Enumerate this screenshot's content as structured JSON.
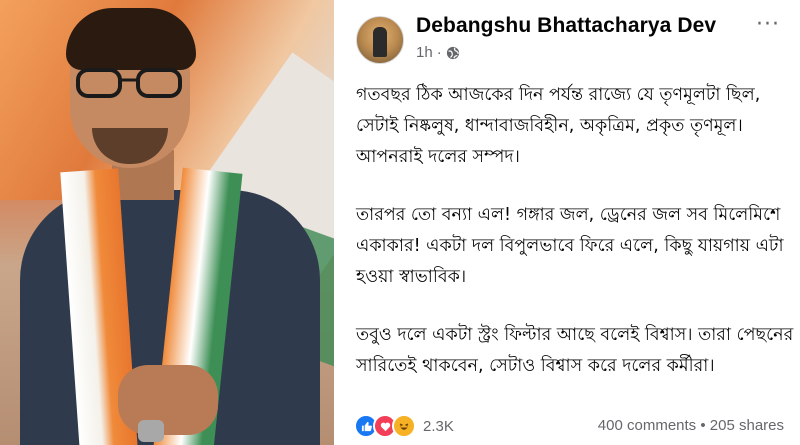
{
  "post": {
    "author": "Debangshu Bhattacharya Dev",
    "time": "1h",
    "time_separator": "·",
    "more_label": "···",
    "paragraphs": [
      "গতবছর ঠিক আজকের দিন পর্যন্ত রাজ্যে যে তৃণমূলটা ছিল, সেটাই নিষ্কলুষ, ধান্দাবাজবিহীন, অকৃত্রিম, প্রকৃত তৃণমূল। আপনরাই দলের সম্পদ।",
      "তারপর তো বন্যা এল! গঙ্গার জল, ড্রেনের জল সব মিলেমিশে একাকার! একটা দল বিপুলভাবে ফিরে এলে, কিছু যায়গায় এটা হওয়া স্বাভাবিক।",
      "তবুও দলে একটা স্ট্রং ফিল্টার আছে বলেই বিশ্বাস। তারা পেছনের সারিতেই থাকবেন, সেটাও বিশ্বাস করে দলের কর্মীরা।"
    ]
  },
  "footer": {
    "reaction_count": "2.3K",
    "comments": "400 comments",
    "shares": "205 shares",
    "stats_separator": " • "
  },
  "colors": {
    "like": "#1877f2",
    "love": "#f33e58",
    "haha": "#f7b125",
    "meta_text": "#65676b"
  },
  "icons": [
    "globe-icon",
    "more-options-icon",
    "like-reaction-icon",
    "love-reaction-icon",
    "haha-reaction-icon"
  ]
}
